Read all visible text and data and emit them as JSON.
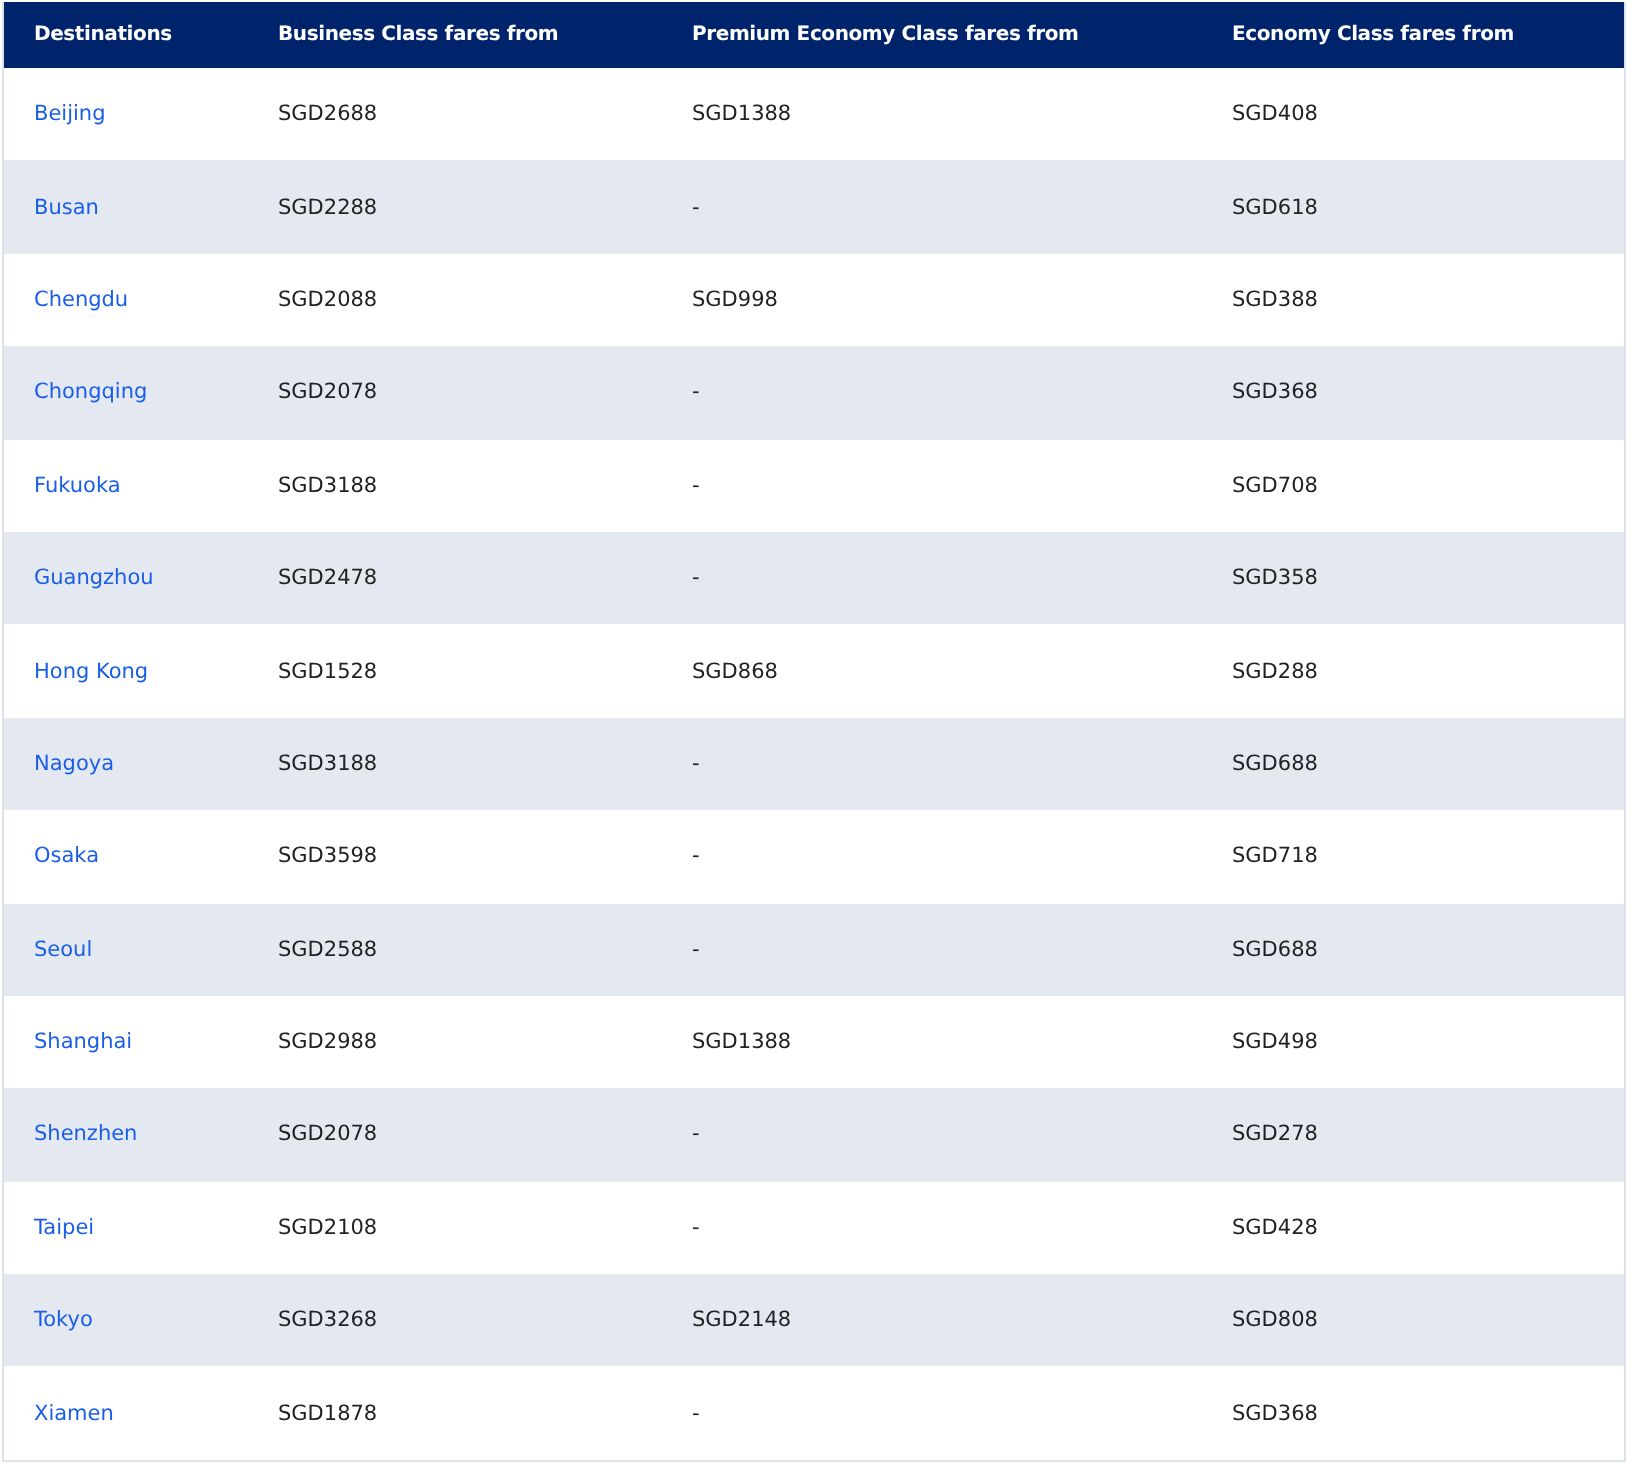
{
  "table": {
    "columns": [
      "Destinations",
      "Business Class fares from",
      "Premium Economy Class fares from",
      "Economy Class fares from"
    ],
    "rows": [
      [
        "Beijing",
        "SGD2688",
        "SGD1388",
        "SGD408"
      ],
      [
        "Busan",
        "SGD2288",
        "-",
        "SGD618"
      ],
      [
        "Chengdu",
        "SGD2088",
        "SGD998",
        "SGD388"
      ],
      [
        "Chongqing",
        "SGD2078",
        "-",
        "SGD368"
      ],
      [
        "Fukuoka",
        "SGD3188",
        "-",
        "SGD708"
      ],
      [
        "Guangzhou",
        "SGD2478",
        "-",
        "SGD358"
      ],
      [
        "Hong Kong",
        "SGD1528",
        "SGD868",
        "SGD288"
      ],
      [
        "Nagoya",
        "SGD3188",
        "-",
        "SGD688"
      ],
      [
        "Osaka",
        "SGD3598",
        "-",
        "SGD718"
      ],
      [
        "Seoul",
        "SGD2588",
        "-",
        "SGD688"
      ],
      [
        "Shanghai",
        "SGD2988",
        "SGD1388",
        "SGD498"
      ],
      [
        "Shenzhen",
        "SGD2078",
        "-",
        "SGD278"
      ],
      [
        "Taipei",
        "SGD2108",
        "-",
        "SGD428"
      ],
      [
        "Tokyo",
        "SGD3268",
        "SGD2148",
        "SGD808"
      ],
      [
        "Xiamen",
        "SGD1878",
        "-",
        "SGD368"
      ]
    ]
  }
}
